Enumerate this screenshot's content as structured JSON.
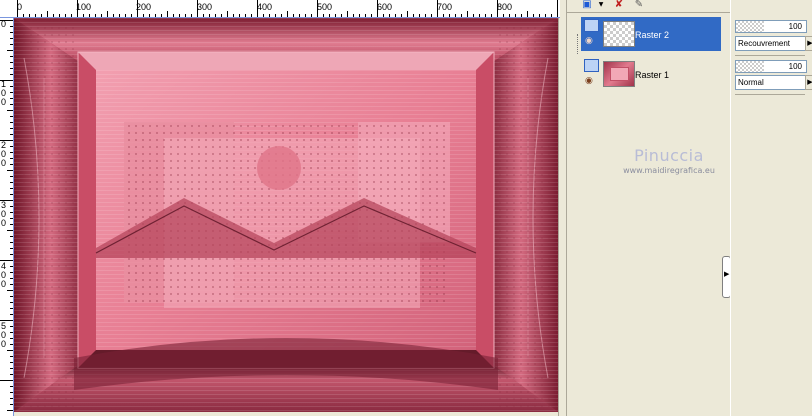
{
  "ruler_top": {
    "labels": [
      "0",
      "100",
      "200",
      "300",
      "400",
      "500",
      "600",
      "700",
      "800"
    ]
  },
  "ruler_left": {
    "labels": [
      "0",
      "1 0 0",
      "2 0 0",
      "3 0 0",
      "4 0 0",
      "5 0 0"
    ]
  },
  "layers_panel": {
    "layers": [
      {
        "name": "Raster 2",
        "selected": true,
        "thumb": "transparent"
      },
      {
        "name": "Raster 1",
        "selected": false,
        "thumb": "pink-image"
      }
    ]
  },
  "properties": {
    "rows": [
      {
        "opacity": "100",
        "blend_mode": "Recouvrement"
      },
      {
        "opacity": "100",
        "blend_mode": "Normal"
      }
    ]
  },
  "watermark": {
    "title": "Pinuccia",
    "url": "www.maidiregrafica.eu"
  },
  "colors": {
    "selection": "#316ac5",
    "panel_bg": "#ece9d8",
    "canvas_base": "#b83a55"
  }
}
